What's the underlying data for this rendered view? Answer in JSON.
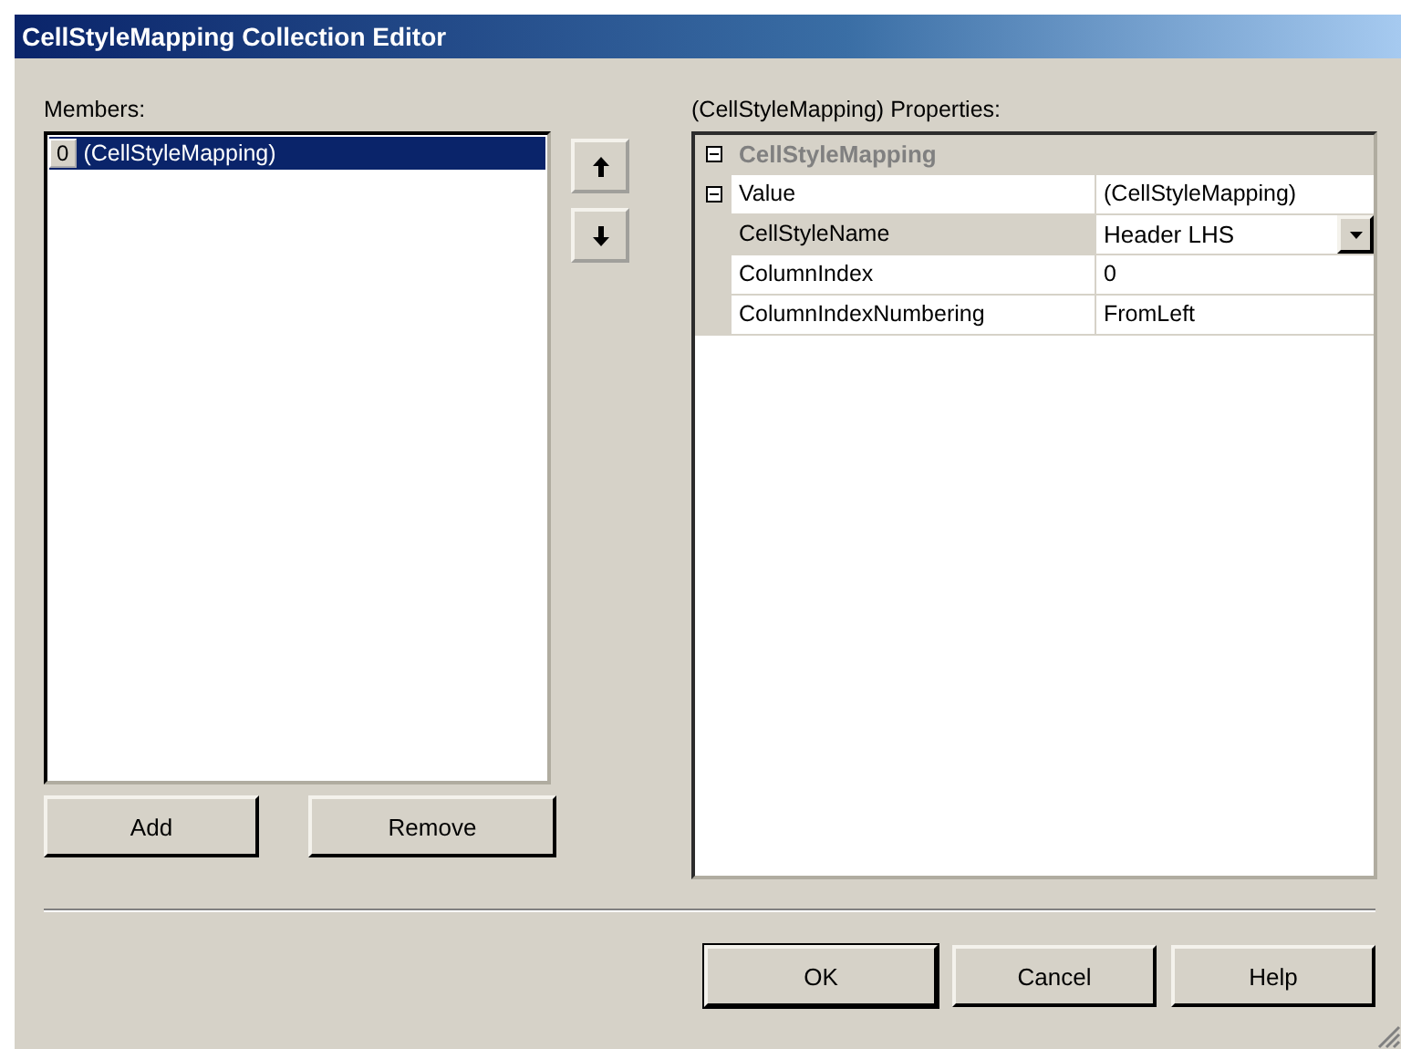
{
  "window": {
    "title": "CellStyleMapping Collection Editor"
  },
  "members": {
    "label": "Members:",
    "items": [
      {
        "index": "0",
        "text": "(CellStyleMapping)",
        "selected": true
      }
    ]
  },
  "member_actions": [
    {
      "label": "Add"
    },
    {
      "label": "Remove"
    }
  ],
  "properties": {
    "label": "(CellStyleMapping)  Properties:",
    "categories": [
      {
        "name": "CellStyleMapping",
        "expanded": true,
        "properties": [
          {
            "name": "Value",
            "value": "(CellStyleMapping)",
            "expanded": true,
            "children": [
              {
                "name": "CellStyleName",
                "value": "Header LHS",
                "selected": true,
                "kind": "dropdown"
              },
              {
                "name": "ColumnIndex",
                "value": "0",
                "selected": false,
                "kind": "text"
              },
              {
                "name": "ColumnIndexNumbering",
                "value": "FromLeft",
                "selected": false,
                "kind": "text"
              }
            ]
          }
        ]
      }
    ]
  },
  "dialog_buttons": [
    {
      "label": "OK",
      "default": true
    },
    {
      "label": "Cancel",
      "default": false
    },
    {
      "label": "Help",
      "default": false
    }
  ]
}
